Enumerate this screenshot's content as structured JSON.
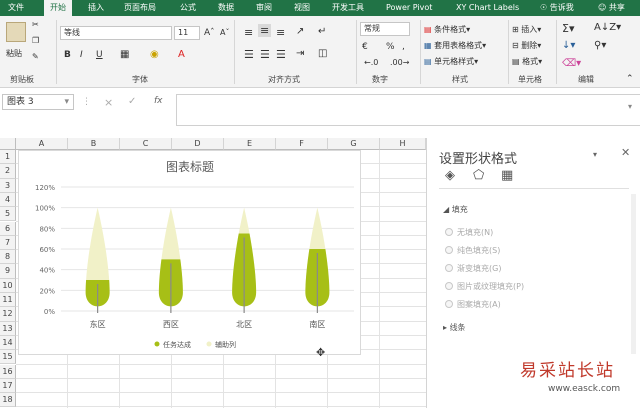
{
  "ribbon_tabs": [
    "文件",
    "开始",
    "插入",
    "页面布局",
    "公式",
    "数据",
    "审阅",
    "视图",
    "开发工具",
    "Power Pivot",
    "XY Chart Labels"
  ],
  "tell_me": "告诉我",
  "share": "共享",
  "clipboard": {
    "paste": "粘贴",
    "group": "剪贴板"
  },
  "font": {
    "name": "等线",
    "size": "11",
    "group": "字体"
  },
  "alignment": {
    "group": "对齐方式"
  },
  "number": {
    "format": "常规",
    "group": "数字"
  },
  "styles": {
    "cond": "条件格式",
    "table": "套用表格格式",
    "cell": "单元格样式",
    "group": "样式"
  },
  "cells": {
    "insert": "插入",
    "delete": "删除",
    "format": "格式",
    "group": "单元格"
  },
  "editing": {
    "group": "编辑"
  },
  "name_box": "图表 3",
  "formula_icons": {
    "cancel": "×",
    "enter": "✓",
    "fx": "fx"
  },
  "columns": [
    "A",
    "B",
    "C",
    "D",
    "E",
    "F",
    "G",
    "H"
  ],
  "rows": [
    "1",
    "2",
    "3",
    "4",
    "5",
    "6",
    "7",
    "8",
    "9",
    "10",
    "11",
    "12",
    "13",
    "14",
    "15",
    "16",
    "17",
    "18"
  ],
  "pane": {
    "title": "设置形状格式",
    "fill_section": "填充",
    "options": [
      "无填充(N)",
      "纯色填充(S)",
      "渐变填充(G)",
      "图片或纹理填充(P)",
      "图案填充(A)"
    ],
    "line_section": "线条"
  },
  "watermark": {
    "site": "易采站长站",
    "url": "www.easck.com"
  },
  "colors": {
    "excel_green": "#217346",
    "leaf_fill": "#a7bf16",
    "leaf_bg": "#f1f1c8"
  },
  "chart_data": {
    "type": "bar",
    "title": "图表标题",
    "categories": [
      "东区",
      "西区",
      "北区",
      "南区"
    ],
    "series": [
      {
        "name": "任务达成",
        "values": [
          0.3,
          0.5,
          0.75,
          0.6
        ]
      },
      {
        "name": "辅助列",
        "values": [
          1.0,
          1.0,
          1.0,
          1.0
        ]
      }
    ],
    "yticks": [
      "0%",
      "20%",
      "40%",
      "60%",
      "80%",
      "100%",
      "120%"
    ],
    "ylim": [
      0,
      1.2
    ],
    "grid": true,
    "legend": "bottom"
  }
}
